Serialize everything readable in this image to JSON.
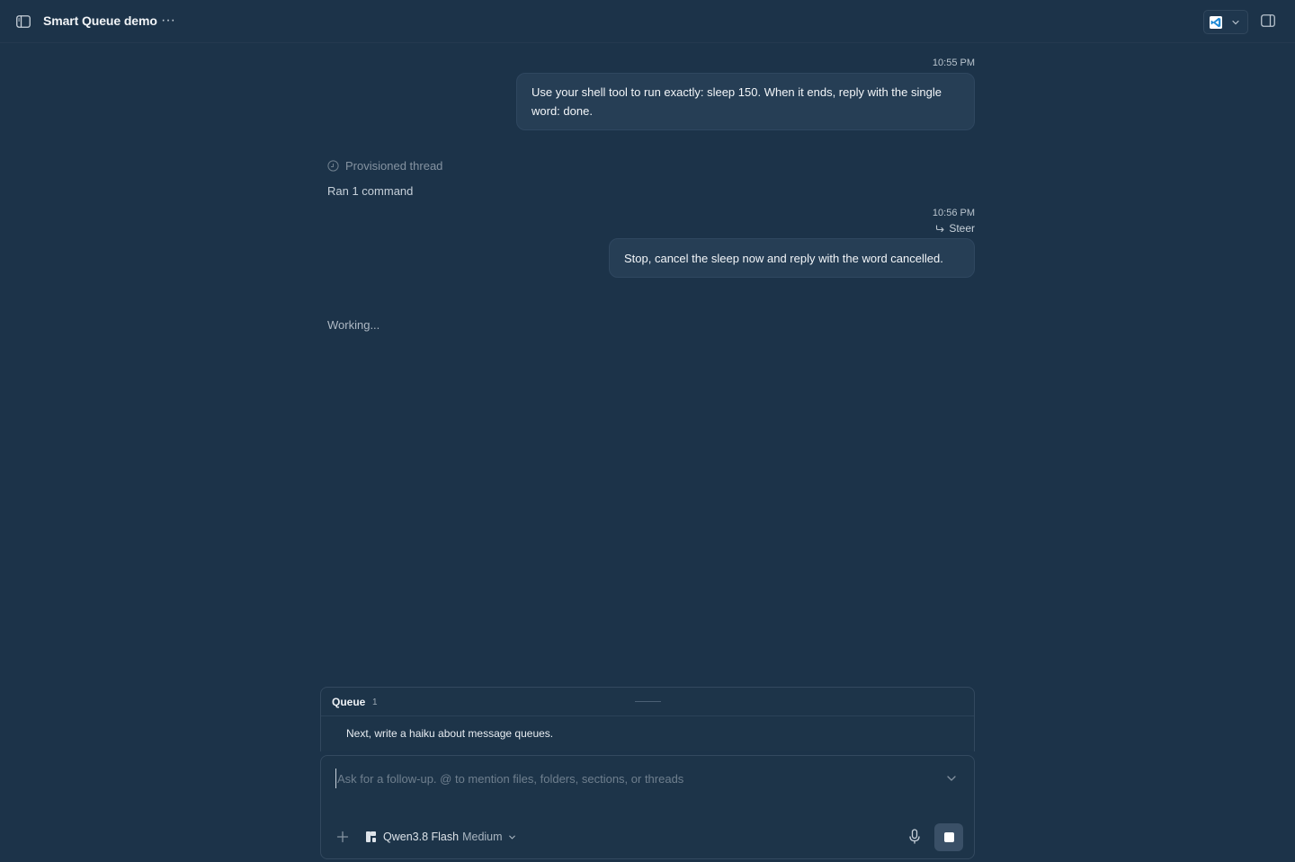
{
  "header": {
    "title": "Smart Queue demo",
    "more_label": "···",
    "icons": {
      "sidebar": "sidebar-toggle-icon",
      "editor": "vscode-icon",
      "right_panel": "right-panel-icon"
    }
  },
  "conversation": {
    "messages": [
      {
        "timestamp": "10:55 PM",
        "text": "Use your shell tool to run exactly: sleep 150. When it ends, reply with the single word: done."
      },
      {
        "timestamp": "10:56 PM",
        "tag": "Steer",
        "text": "Stop, cancel the sleep now and reply with the word cancelled."
      }
    ],
    "provisioned_label": "Provisioned thread",
    "ran_label": "Ran 1 command",
    "status": "Working..."
  },
  "queue": {
    "title": "Queue",
    "count": "1",
    "items": [
      {
        "text": "Next, write a haiku about message queues."
      }
    ]
  },
  "composer": {
    "placeholder": "Ask for a follow-up. @ to mention files, folders, sections, or threads",
    "value": "",
    "model": {
      "name": "Qwen3.8 Flash",
      "level": "Medium"
    }
  },
  "colors": {
    "background": "#1c3349",
    "bubble": "#263e55",
    "stop_button": "#3a5067"
  }
}
